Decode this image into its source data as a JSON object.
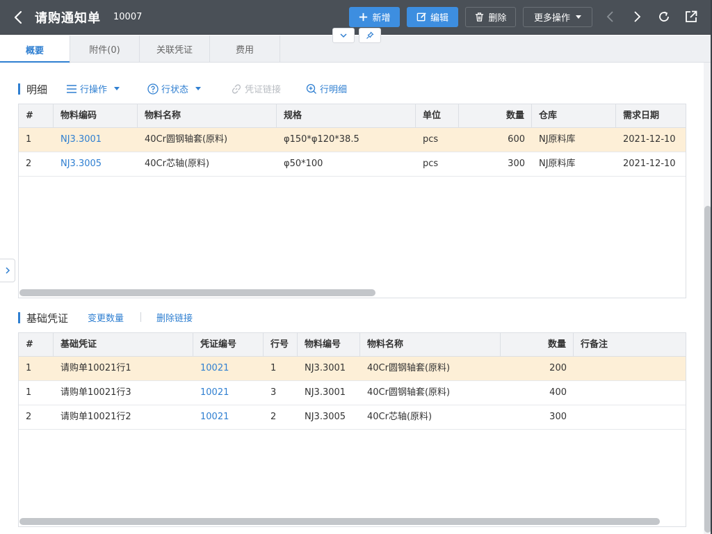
{
  "header": {
    "title": "请购通知单",
    "doc_no": "10007",
    "buttons": {
      "new": "新增",
      "edit": "编辑",
      "delete": "删除",
      "more": "更多操作"
    }
  },
  "tabs": [
    {
      "label": "概要"
    },
    {
      "label": "附件(0)"
    },
    {
      "label": "关联凭证"
    },
    {
      "label": "费用"
    }
  ],
  "detail": {
    "title": "明细",
    "tools": {
      "row_ops": "行操作",
      "row_status": "行状态",
      "voucher_link": "凭证链接",
      "row_detail": "行明细"
    },
    "columns": [
      "#",
      "物料编码",
      "物料名称",
      "规格",
      "单位",
      "数量",
      "仓库",
      "需求日期"
    ],
    "rows": [
      {
        "idx": "1",
        "code": "NJ3.3001",
        "name": "40Cr圆钢轴套(原料)",
        "spec": "φ150*φ120*38.5",
        "unit": "pcs",
        "qty": "600",
        "warehouse": "NJ原料库",
        "date": "2021-12-10"
      },
      {
        "idx": "2",
        "code": "NJ3.3005",
        "name": "40Cr芯轴(原料)",
        "spec": "φ50*100",
        "unit": "pcs",
        "qty": "300",
        "warehouse": "NJ原料库",
        "date": "2021-12-10"
      }
    ]
  },
  "base": {
    "title": "基础凭证",
    "tools": {
      "change_qty": "变更数量",
      "delete_link": "删除链接"
    },
    "columns": [
      "#",
      "基础凭证",
      "凭证编号",
      "行号",
      "物料编号",
      "物料名称",
      "数量",
      "行备注"
    ],
    "rows": [
      {
        "idx": "1",
        "voucher": "请购单10021行1",
        "vno": "10021",
        "line": "1",
        "code": "NJ3.3001",
        "name": "40Cr圆钢轴套(原料)",
        "qty": "200",
        "remark": ""
      },
      {
        "idx": "1",
        "voucher": "请购单10021行3",
        "vno": "10021",
        "line": "3",
        "code": "NJ3.3001",
        "name": "40Cr圆钢轴套(原料)",
        "qty": "400",
        "remark": ""
      },
      {
        "idx": "2",
        "voucher": "请购单10021行2",
        "vno": "10021",
        "line": "2",
        "code": "NJ3.3005",
        "name": "40Cr芯轴(原料)",
        "qty": "300",
        "remark": ""
      }
    ]
  },
  "colors": {
    "header_bg": "#4a5057",
    "accent": "#2f7fd1",
    "primary_button": "#3d8ee0",
    "selected_row": "#fdefd7"
  }
}
